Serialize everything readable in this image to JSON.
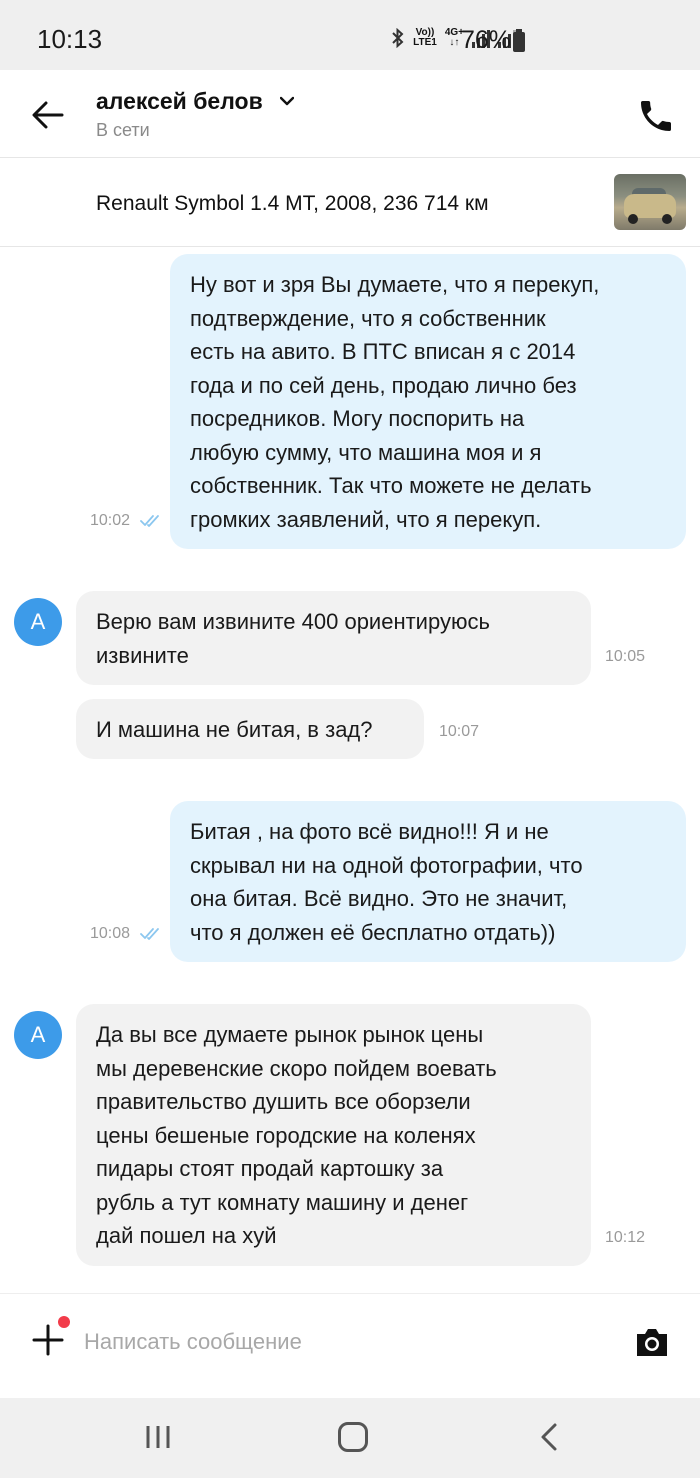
{
  "status_bar": {
    "time": "10:13",
    "volte": "Vo))",
    "lte": "LTE1",
    "net": "4G+",
    "battery": "76%"
  },
  "header": {
    "contact_name": "алексей белов",
    "contact_status": "В сети"
  },
  "listing": {
    "title": "Renault Symbol 1.4 MT, 2008, 236 714 км"
  },
  "messages": [
    {
      "direction": "out",
      "lines": [
        "Ну вот и зря Вы думаете,  что я перекуп,",
        "подтверждение,  что я собственник",
        "есть на авито.  В ПТС вписан я с 2014",
        "года и по сей день,  продаю лично без",
        "посредников.  Могу поспорить на",
        "любую сумму,  что машина моя и я",
        "собственник. Так что можете не делать",
        "громких заявлений,  что я перекуп."
      ],
      "time": "10:02",
      "read": true
    },
    {
      "direction": "in",
      "avatar": "А",
      "lines": [
        "Верю вам извините 400 ориентируюсь",
        "извините"
      ],
      "time": "10:05"
    },
    {
      "direction": "in",
      "lines": [
        "И машина не битая, в зад?"
      ],
      "time": "10:07"
    },
    {
      "direction": "out",
      "lines": [
        "Битая , на фото всё видно!!! Я и не",
        "скрывал ни на одной фотографии,  что",
        "она битая. Всё видно. Это не значит,",
        "что я должен её бесплатно отдать))"
      ],
      "time": "10:08",
      "read": true
    },
    {
      "direction": "in",
      "avatar": "А",
      "lines": [
        "Да вы все думаете рынок рынок цены",
        "мы деревенские скоро пойдем воевать",
        "правительство душить все оборзели",
        "цены бешеные городские на коленях",
        "пидары стоят продай картошку за",
        "рубль а тут комнату машину и денег",
        "дай пошел на хуй"
      ],
      "time": "10:12"
    }
  ],
  "composer": {
    "placeholder": "Написать сообщение",
    "value": ""
  },
  "colors": {
    "outgoing_bubble": "#e3f3fd",
    "incoming_bubble": "#f2f2f2",
    "avatar": "#3d9be9",
    "read_ticks": "#8cc7ef",
    "notification_dot": "#f23b4a"
  },
  "icons": {
    "back": "arrow-left-icon",
    "dropdown": "chevron-down-icon",
    "call": "phone-icon",
    "attach": "plus-icon",
    "camera": "camera-icon",
    "read": "double-check-icon"
  }
}
